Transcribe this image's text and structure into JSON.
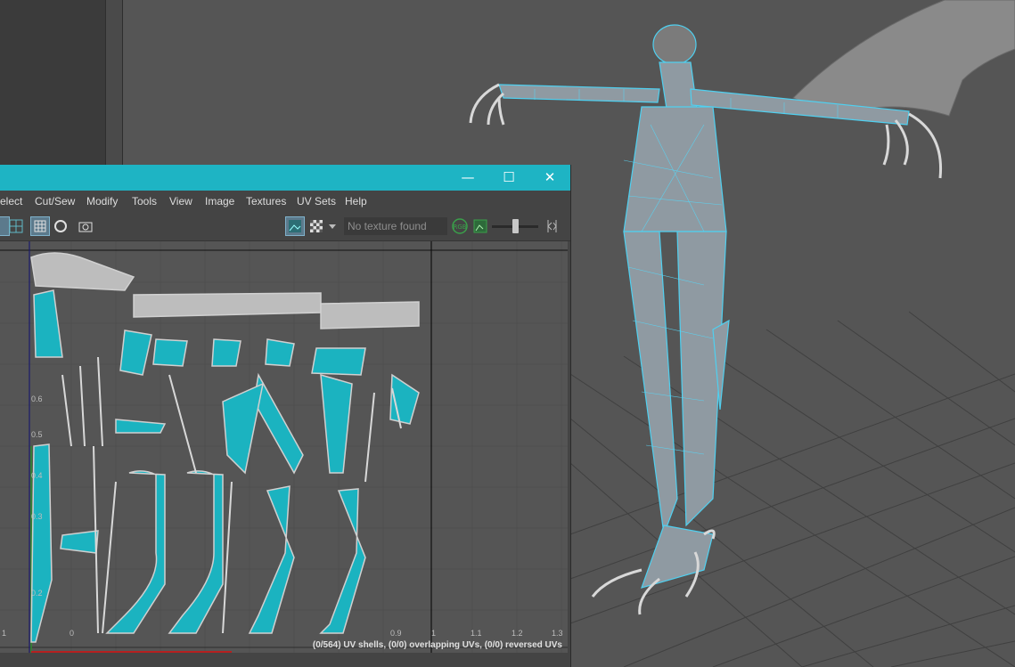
{
  "uv_editor": {
    "window_controls": {
      "minimize": "—",
      "maximize": "☐",
      "close": "✕"
    },
    "menu": [
      "elect",
      "Cut/Sew",
      "Modify",
      "Tools",
      "View",
      "Image",
      "Textures",
      "UV Sets",
      "Help"
    ],
    "texture_placeholder": "No texture found",
    "rgb_label": "RGB",
    "status_text": "(0/564) UV shells, (0/0) overlapping UVs, (0/0) reversed UVs",
    "u_axis_ticks": [
      "1",
      "0",
      "0.9",
      "1",
      "1.1",
      "1.2",
      "1.3"
    ],
    "v_axis_ticks": [
      "0.6",
      "0.5",
      "0.4",
      "0.3",
      "0.2"
    ],
    "icons": [
      "uv-grid-icon",
      "checker-icon",
      "dropdown-icon",
      "image-display-icon",
      "texture-border-icon",
      "snapshot-icon",
      "rgb-channel-icon",
      "alpha-channel-icon",
      "exposure-handle-icon"
    ]
  },
  "viewport": {
    "object": "winged-creature-mesh",
    "wireframe_color": "#4fd0f0",
    "grid_color": "#3f3f3f"
  },
  "colors": {
    "title_bar": "#1eb4c4",
    "uv_shell": "#1bb3c0",
    "background": "#555555"
  }
}
